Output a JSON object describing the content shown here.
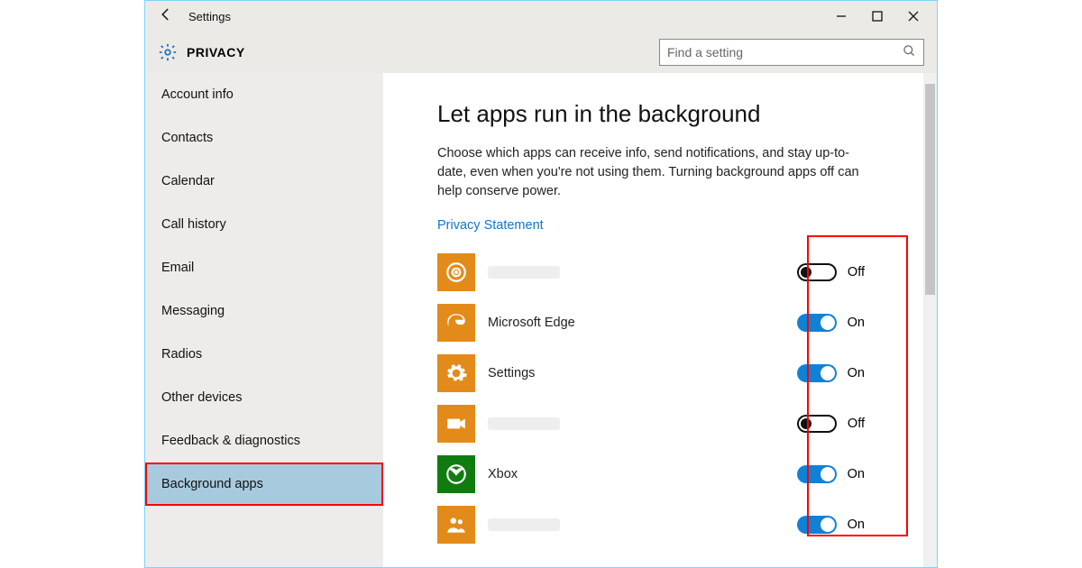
{
  "window": {
    "title": "Settings"
  },
  "header": {
    "category": "PRIVACY",
    "search_placeholder": "Find a setting"
  },
  "sidebar": {
    "items": [
      {
        "label": "Account info"
      },
      {
        "label": "Contacts"
      },
      {
        "label": "Calendar"
      },
      {
        "label": "Call history"
      },
      {
        "label": "Email"
      },
      {
        "label": "Messaging"
      },
      {
        "label": "Radios"
      },
      {
        "label": "Other devices"
      },
      {
        "label": "Feedback & diagnostics"
      },
      {
        "label": "Background apps",
        "selected": true
      }
    ]
  },
  "main": {
    "heading": "Let apps run in the background",
    "description": "Choose which apps can receive info, send notifications, and stay up-to-date, even when you're not using them. Turning background apps off can help conserve power.",
    "link": "Privacy Statement",
    "apps": [
      {
        "name": "",
        "icon": "target",
        "state": "Off"
      },
      {
        "name": "Microsoft Edge",
        "icon": "edge",
        "state": "On"
      },
      {
        "name": "Settings",
        "icon": "gear",
        "state": "On"
      },
      {
        "name": "",
        "icon": "camera",
        "state": "Off"
      },
      {
        "name": "Xbox",
        "icon": "xbox",
        "state": "On"
      },
      {
        "name": "",
        "icon": "people",
        "state": "On"
      }
    ]
  }
}
